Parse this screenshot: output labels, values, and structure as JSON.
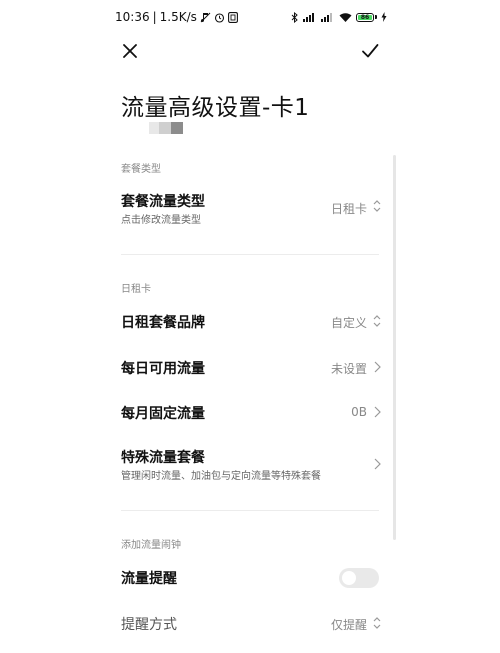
{
  "status_bar": {
    "time": "10:36",
    "speed": "1.5K/s",
    "battery_level": "86"
  },
  "header": {
    "title": "流量高级设置-卡1"
  },
  "sections": {
    "plan_type": {
      "header": "套餐类型",
      "rows": [
        {
          "title": "套餐流量类型",
          "subtitle": "点击修改流量类型",
          "value": "日租卡",
          "control": "updown"
        }
      ]
    },
    "daily_card": {
      "header": "日租卡",
      "rows": [
        {
          "title": "日租套餐品牌",
          "value": "自定义",
          "control": "updown"
        },
        {
          "title": "每日可用流量",
          "value": "未设置",
          "control": "chevron"
        },
        {
          "title": "每月固定流量",
          "value": "0B",
          "control": "chevron"
        },
        {
          "title": "特殊流量套餐",
          "subtitle": "管理闲时流量、加油包与定向流量等特殊套餐",
          "value": "",
          "control": "chevron"
        }
      ]
    },
    "alarm": {
      "header": "添加流量闹钟",
      "rows": [
        {
          "title": "流量提醒",
          "toggle_on": false
        },
        {
          "title": "提醒方式",
          "value": "仅提醒",
          "control": "updown"
        }
      ]
    }
  },
  "colors": {
    "accent_battery": "#4cd964",
    "divider": "#ececec",
    "secondary_text": "#888888"
  }
}
